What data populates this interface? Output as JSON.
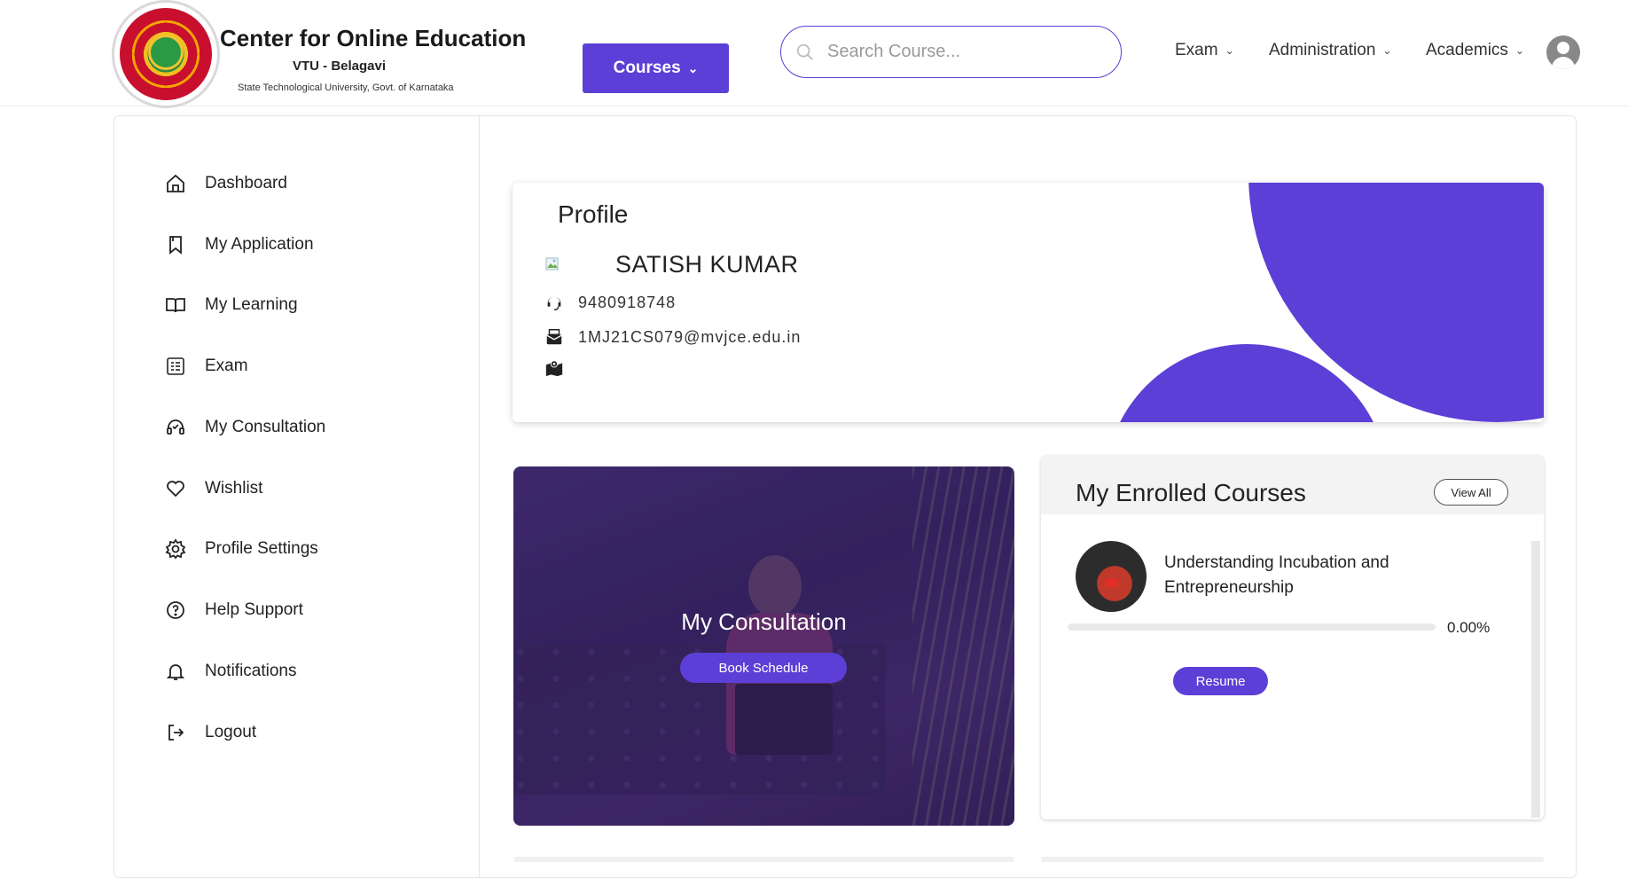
{
  "brand": {
    "title": "Center for Online Education",
    "subtitle": "VTU - Belagavi",
    "tagline": "State Technological University, Govt. of Karnataka"
  },
  "header": {
    "courses_label": "Courses",
    "search_placeholder": "Search Course...",
    "nav": [
      {
        "label": "Exam"
      },
      {
        "label": "Administration"
      },
      {
        "label": "Academics"
      }
    ]
  },
  "sidebar": {
    "items": [
      {
        "label": "Dashboard",
        "icon": "home-icon"
      },
      {
        "label": "My Application",
        "icon": "bookmark-icon"
      },
      {
        "label": "My Learning",
        "icon": "book-open-icon"
      },
      {
        "label": "Exam",
        "icon": "exam-icon"
      },
      {
        "label": "My Consultation",
        "icon": "headset-icon"
      },
      {
        "label": "Wishlist",
        "icon": "heart-icon"
      },
      {
        "label": "Profile Settings",
        "icon": "gear-icon"
      },
      {
        "label": "Help Support",
        "icon": "help-icon"
      },
      {
        "label": "Notifications",
        "icon": "bell-icon"
      },
      {
        "label": "Logout",
        "icon": "logout-icon"
      }
    ]
  },
  "profile": {
    "title": "Profile",
    "name": "SATISH KUMAR",
    "phone": "9480918748",
    "email": "1MJ21CS079@mvjce.edu.in",
    "address": ""
  },
  "consultation": {
    "title": "My Consultation",
    "button": "Book Schedule"
  },
  "enrolled": {
    "title": "My Enrolled Courses",
    "view_all": "View All",
    "courses": [
      {
        "name": "Understanding Incubation and Entrepreneurship",
        "progress_text": "0.00%",
        "progress": 0.0,
        "action": "Resume"
      }
    ]
  },
  "colors": {
    "accent": "#5b3fd6"
  }
}
